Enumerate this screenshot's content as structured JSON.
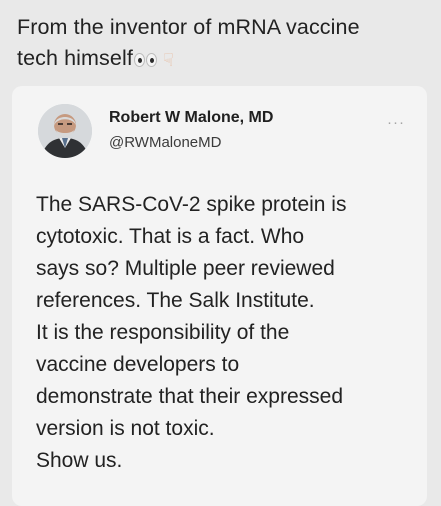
{
  "caption": {
    "line1": "From the inventor of mRNA vaccine",
    "line2": "tech himself"
  },
  "tweet": {
    "author_name": "Robert W Malone, MD",
    "author_handle": "@RWMaloneMD",
    "more_label": "···",
    "lines": [
      "The SARS-CoV-2 spike protein is",
      "cytotoxic.  That is a fact.  Who",
      "says so?  Multiple peer reviewed",
      "references. The Salk Institute.",
      "It is the responsibility of the",
      "vaccine developers to",
      "demonstrate that their expressed",
      "version is not toxic.",
      "Show us."
    ]
  }
}
